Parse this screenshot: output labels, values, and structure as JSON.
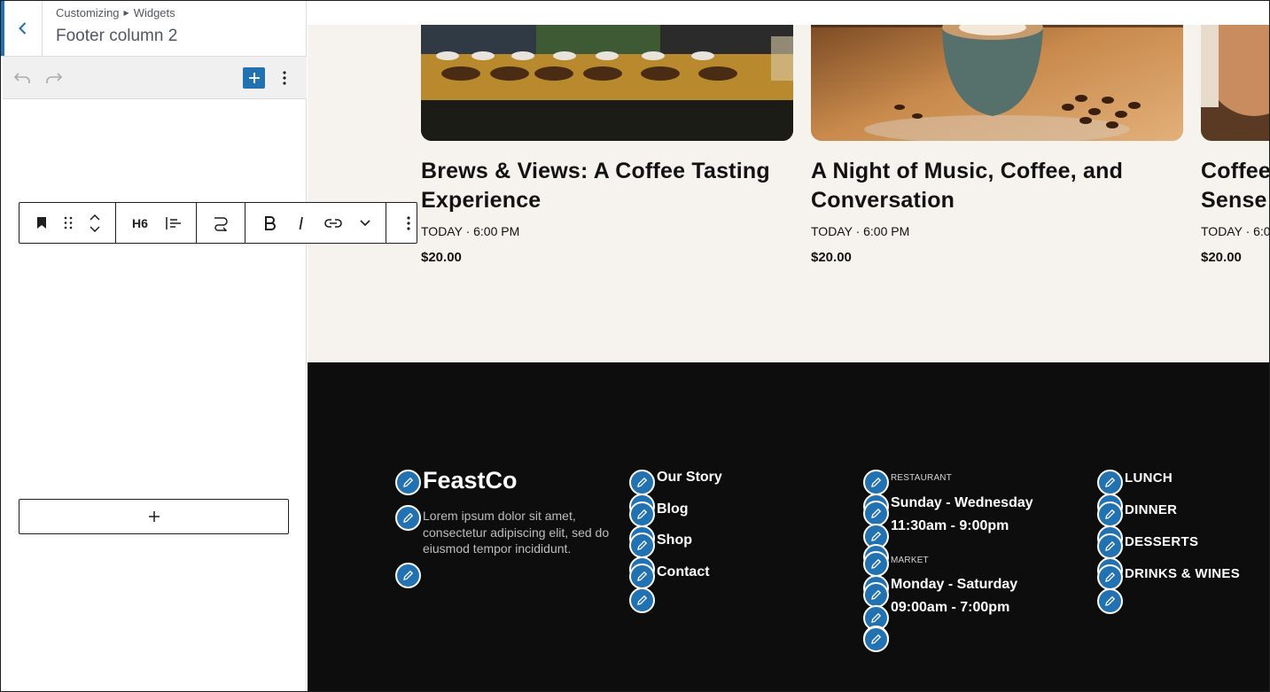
{
  "panel": {
    "breadcrumb": [
      "Customizing",
      "Widgets"
    ],
    "title": "Footer column 2",
    "block_toolbar": {
      "heading_level": "H6"
    }
  },
  "preview": {
    "cards": [
      {
        "title_line1": "Brews & Views: A Coffee Tasting",
        "title_line2": "Experience",
        "time": "TODAY · 6:00 PM",
        "price": "$20.00"
      },
      {
        "title_line1": "A Night of Music, Coffee, and",
        "title_line2": "Conversation",
        "time": "TODAY · 6:00 PM",
        "price": "$20.00"
      },
      {
        "title_line1": "Coffee",
        "title_line2": "Sense",
        "time": "TODAY · 6:0",
        "price": "$20.00"
      }
    ],
    "footer": {
      "brand": "FeastCo",
      "description": "Lorem ipsum dolor sit amet, consectetur adipiscing elit, sed do eiusmod tempor incididunt.",
      "links": [
        "Our Story",
        "Blog",
        "Shop",
        "Contact"
      ],
      "hours": {
        "restaurant_label": "RESTAURANT",
        "restaurant_days": "Sunday - Wednesday",
        "restaurant_time": "11:30am - 9:00pm",
        "market_label": "MARKET",
        "market_days": "Monday - Saturday",
        "market_time": "09:00am - 7:00pm"
      },
      "menu": [
        "LUNCH",
        "DINNER",
        "DESSERTS",
        "DRINKS & WINES"
      ]
    }
  },
  "colors": {
    "accent": "#2271b1",
    "footer_bg": "#0d0d0d",
    "preview_bg": "#f6f3ee"
  }
}
